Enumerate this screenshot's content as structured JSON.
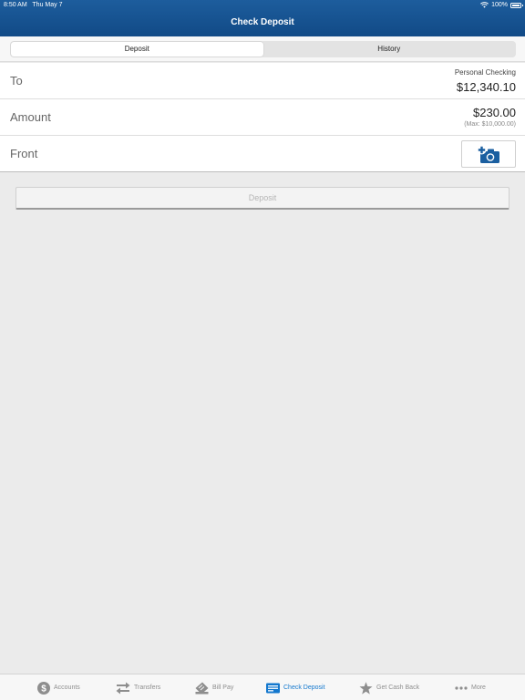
{
  "status_bar": {
    "time": "8:50 AM",
    "date": "Thu May 7",
    "battery": "100%"
  },
  "header": {
    "title": "Check Deposit"
  },
  "segments": {
    "deposit": "Deposit",
    "history": "History",
    "selected": "Deposit"
  },
  "form": {
    "to": {
      "label": "To",
      "account_name": "Personal Checking",
      "balance": "$12,340.10"
    },
    "amount": {
      "label": "Amount",
      "value": "$230.00",
      "max": "(Max: $10,000.00)"
    },
    "front": {
      "label": "Front",
      "icon": "add-camera-icon"
    }
  },
  "deposit_button": {
    "label": "Deposit",
    "enabled": false
  },
  "tabbar": {
    "items": [
      {
        "label": "Accounts",
        "icon": "dollar-circle-icon"
      },
      {
        "label": "Transfers",
        "icon": "transfer-arrows-icon"
      },
      {
        "label": "Bill Pay",
        "icon": "bill-pay-icon"
      },
      {
        "label": "Check Deposit",
        "icon": "check-deposit-icon"
      },
      {
        "label": "Get Cash Back",
        "icon": "star-icon"
      },
      {
        "label": "More",
        "icon": "more-dots-icon"
      }
    ],
    "active": "Check Deposit"
  },
  "colors": {
    "header": "#114a86",
    "accent": "#1478ce",
    "background": "#ebebeb"
  }
}
